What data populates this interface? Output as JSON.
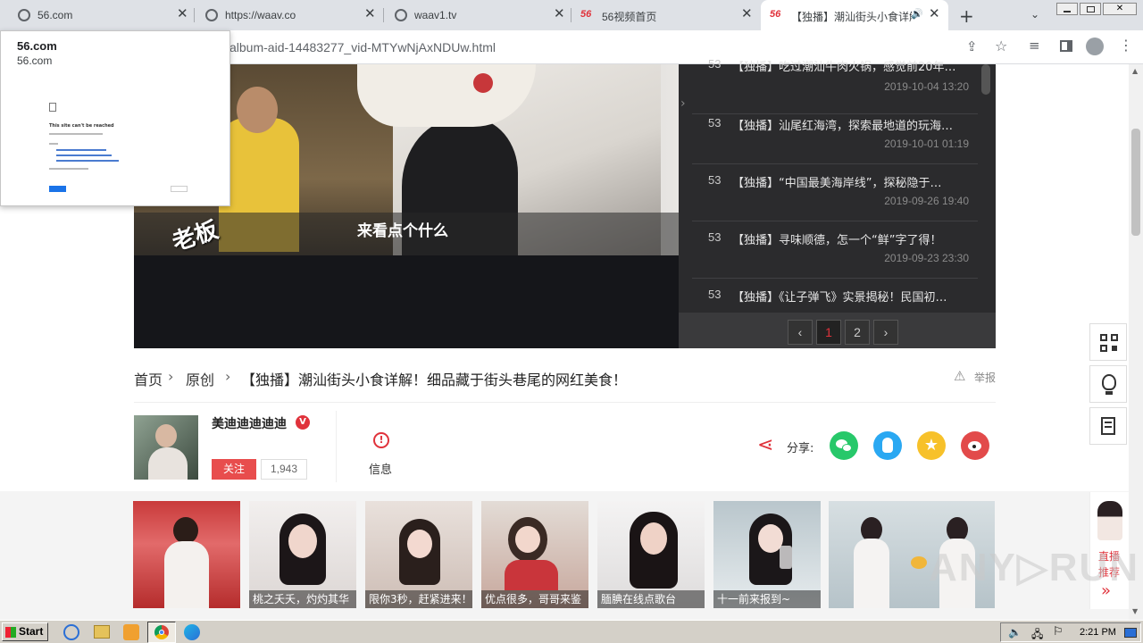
{
  "tabs": [
    {
      "title": "56.com",
      "type": "globe"
    },
    {
      "title": "https://waav.co",
      "type": "globe"
    },
    {
      "title": "waav1.tv",
      "type": "globe"
    },
    {
      "title": "56视频首页",
      "type": "56"
    },
    {
      "title": "【独播】潮汕街头小食详解",
      "type": "56",
      "active": true
    }
  ],
  "address": {
    "url": "album-aid-14483277_vid-MTYwNjAxNDUw.html"
  },
  "popup": {
    "heading": "56.com",
    "subheading": "56.com",
    "error_title": "This site can't be reached"
  },
  "video": {
    "subtitle": "来看点个什么",
    "watermark": "老板"
  },
  "playlist": {
    "items": [
      {
        "num": "53",
        "title": "【独播】吃过潮汕牛肉火锅，感觉前20年…",
        "date": "2019-10-04 13:20"
      },
      {
        "num": "53",
        "title": "【独播】汕尾红海湾，探索最地道的玩海…",
        "date": "2019-10-01 01:19"
      },
      {
        "num": "53",
        "title": "【独播】“中国最美海岸线”，探秘隐于…",
        "date": "2019-09-26 19:40"
      },
      {
        "num": "53",
        "title": "【独播】寻味顺德，怎一个“鲜”字了得！",
        "date": "2019-09-23 23:30"
      },
      {
        "num": "53",
        "title": "【独播】《让子弹飞》实景揭秘！民国初…",
        "date": ""
      }
    ],
    "pages": [
      "1",
      "2"
    ]
  },
  "breadcrumb": {
    "home": "首页",
    "section": "原创",
    "title": "【独播】潮汕街头小食详解！细品藏于街头巷尾的网红美食！",
    "report": "举报"
  },
  "author": {
    "name": "美迪迪迪迪迪",
    "follow": "关注",
    "fans": "1,943",
    "info": "信息"
  },
  "share": {
    "label": "分享:"
  },
  "thumbs": [
    {
      "caption": ""
    },
    {
      "caption": "桃之夭夭，灼灼其华"
    },
    {
      "caption": "限你3秒，赶紧进来！"
    },
    {
      "caption": "优点很多，哥哥来鉴"
    },
    {
      "caption": "腼腆在线点歌台"
    },
    {
      "caption": "十一前来报到~"
    },
    {
      "caption": ""
    }
  ],
  "live": {
    "line1": "直播",
    "line2": "推荐",
    "arrow": "»"
  },
  "taskbar": {
    "start": "Start",
    "time": "2:21 PM"
  },
  "colors": {
    "accent_red": "#e0323b",
    "wechat": "#27c86a",
    "qq": "#2aa8f2",
    "qzone": "#f7c12a",
    "weibo": "#e24a4a"
  }
}
